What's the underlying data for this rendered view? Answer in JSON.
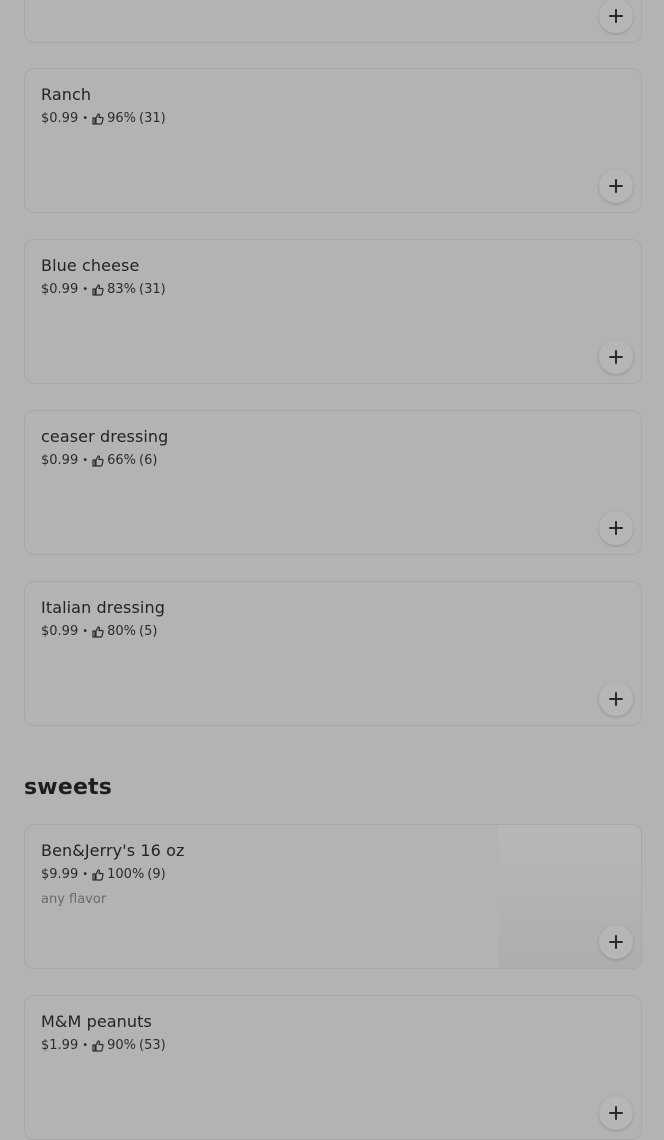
{
  "menu": {
    "partial_top_item": {
      "add_label": "+"
    },
    "items_dressings": [
      {
        "name": "Ranch",
        "price": "$0.99",
        "rating": "96%",
        "count": "(31)"
      },
      {
        "name": "Blue cheese",
        "price": "$0.99",
        "rating": "83%",
        "count": "(31)"
      },
      {
        "name": "ceaser dressing",
        "price": "$0.99",
        "rating": "66%",
        "count": "(6)"
      },
      {
        "name": "Italian dressing",
        "price": "$0.99",
        "rating": "80%",
        "count": "(5)"
      }
    ],
    "section_sweets": {
      "title": "sweets",
      "items": [
        {
          "name": "Ben&Jerry's 16 oz",
          "price": "$9.99",
          "rating": "100%",
          "count": "(9)",
          "description": "any flavor"
        },
        {
          "name": "M&M peanuts",
          "price": "$1.99",
          "rating": "90%",
          "count": "(53)"
        }
      ]
    },
    "separator": "•",
    "icons": {
      "add": "plus-icon",
      "rating": "thumbs-up-icon"
    }
  }
}
